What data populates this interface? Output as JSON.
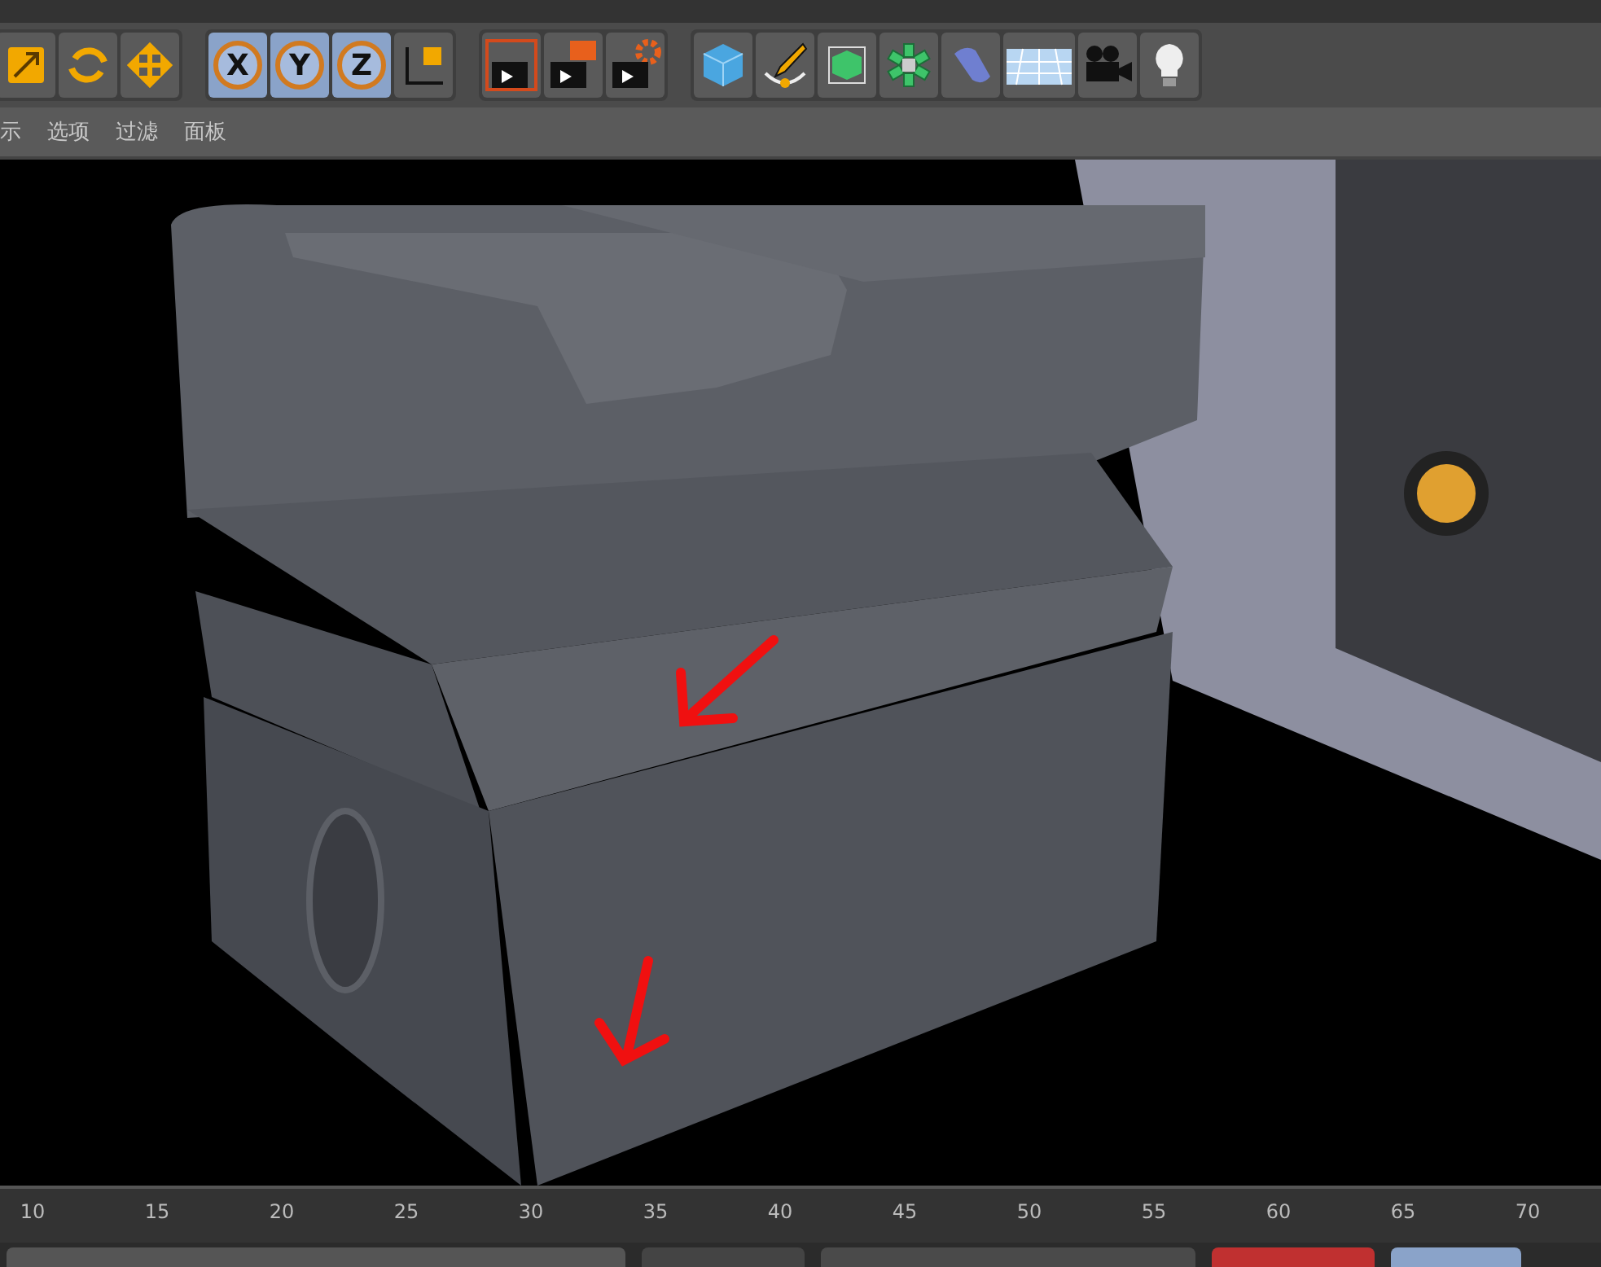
{
  "toolbar": {
    "groups": [
      {
        "tools": [
          {
            "kind": "scale",
            "selected": false
          },
          {
            "kind": "rotate",
            "selected": false
          },
          {
            "kind": "move",
            "selected": false
          }
        ]
      },
      {
        "tools": [
          {
            "kind": "axis",
            "label": "X",
            "selected": true
          },
          {
            "kind": "axis",
            "label": "Y",
            "selected": true
          },
          {
            "kind": "axis",
            "label": "Z",
            "selected": true
          },
          {
            "kind": "coords",
            "selected": false
          }
        ]
      },
      {
        "tools": [
          {
            "kind": "render-view",
            "selected": false
          },
          {
            "kind": "render-picture",
            "selected": false
          },
          {
            "kind": "render-settings",
            "selected": false
          }
        ]
      },
      {
        "tools": [
          {
            "kind": "cube",
            "selected": false
          },
          {
            "kind": "pen",
            "selected": false
          },
          {
            "kind": "subdivide",
            "selected": false
          },
          {
            "kind": "cloner",
            "selected": false
          },
          {
            "kind": "deformer",
            "selected": false
          },
          {
            "kind": "floor",
            "selected": false
          },
          {
            "kind": "camera",
            "selected": false
          },
          {
            "kind": "light",
            "selected": false
          }
        ]
      }
    ]
  },
  "viewport_menu": [
    "示",
    "选项",
    "过滤",
    "面板"
  ],
  "timeline": {
    "ticks": [
      "10",
      "15",
      "20",
      "25",
      "30",
      "35",
      "40",
      "45",
      "50",
      "55",
      "60",
      "65",
      "70"
    ]
  }
}
